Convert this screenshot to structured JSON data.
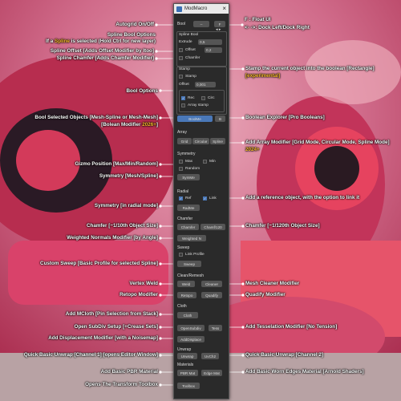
{
  "window": {
    "title": "ModMacro"
  },
  "panel": {
    "bool_label": "Bool",
    "bool_btn": "--",
    "bool_btn_right": "F",
    "spline_bool": "Spline Bool",
    "extrude_label": "Extrude",
    "extrude_value": "0,5",
    "offset_label": "Offset",
    "offset_value": "0,2",
    "chamfer": "Chamfer",
    "stamp_title": "Stamp",
    "stamp": "Stamp",
    "stamp_offset_label": "Offset",
    "stamp_offset_value": "0,001",
    "rec": "Rec",
    "circ": "Circ",
    "array_stamp": "Array stamp",
    "boolme": "BoolMe",
    "boolme_right": "B",
    "array_title": "Array",
    "array_grid": "Grid",
    "array_circular": "Circular",
    "array_spline": "Spline",
    "symmetry_title": "Symmetry",
    "max": "Max",
    "min": "Min",
    "random": "Random",
    "symme": "SymMe",
    "radial_title": "Radial",
    "ref": "Ref",
    "link": "Link",
    "radme": "RadMe",
    "chamfer_title": "Chamfer",
    "chamfer_10": "Chamfer",
    "chamfer_120": "Chamf/120",
    "weighted_n": "Weighted N",
    "sweep_title": "Sweep",
    "link_profile": "Link Profile",
    "sweep": "Sweep",
    "cleanremesh_title": "Clean/Remesh",
    "weld": "Weld",
    "cleaner": "Cleaner",
    "retopo": "Retopo",
    "quadify": "Quadify",
    "cloth_title": "Cloth",
    "cloth": "Cloth",
    "opensubdiv": "OpenSubdiv",
    "tess": "Tess",
    "adddisplace": "AddDisplace",
    "unwrap_title": "Unwrap",
    "unwrap": "Unwrap",
    "uvch2": "UvCh2",
    "materials_title": "Materials",
    "pbr_mat": "PBR Mat",
    "edge_mat": "Edge Mat",
    "toolbox": "Toolbox"
  },
  "left_callouts": {
    "autogrid": "Autogrid On/Off",
    "spline_bool_options": "Spline Bool Options",
    "spline_hint_pre": "If a ",
    "spline_hint_word": "Spline",
    "spline_hint_post": " is selected (Hold Ctrl for new layer)",
    "spline_offset": "Spline Offset [Adds Offset Modifier by Itoo]",
    "spline_chamfer": "Spline Chamfer  [Adds Chamfer Modifier]",
    "bool_options": "Bool Options",
    "bool_selected": "Bool Selected Objects [Mesh-Spline or Mesh-Mesh]",
    "bool_modifier_pre": "[Bolean Modifier ",
    "bool_modifier_ver": "2026+",
    "bool_modifier_post": "]",
    "gizmo_position": "Gizmo Position [Max/Min/Random]",
    "symmetry": "Symmetry [Mesh/Spline]",
    "symmetry_radial": "Symmetry [in radial mode]",
    "chamfer": "Chamfer [~1/10th Object Size]",
    "weighted_normals": "Weighted Normals Modifier [by Angle]",
    "custom_sweep": "Custom Sweep  [Basic Profile for selected Spline]",
    "vertex_weld": "Vertex Weld",
    "retopo": "Retopo Modifier",
    "mcloth": "Add MCloth [Pin Selection from Stack]",
    "open_subdiv": "Open SubDiv Setup [+Crease Sets]",
    "displacement": "Add Displacement Modifier [with a Noisemap]",
    "quick_unwrap1": "Quick Basic Unwrap [Channel 1] [opens Editor Window]",
    "pbr": "Add Basic PBR Material",
    "transform_toolbox": "Opens The Transform Toolbox"
  },
  "right_callouts": {
    "float_ui": "F : Float UI",
    "dock": "<- ->: Dock Left/Dock Right",
    "stamp": "Stamp the current object into the boolean [Rectangle]",
    "stamp_exp": "[experimental]",
    "boolean_explorer": "Boolean Explorer [Pro Booleans]",
    "add_array": "Add Array Modifier [Grid Mode, Circular Mode, Spline Mode]",
    "add_array_ver": "2024+",
    "reference": "Add a reference object, with the option to link it",
    "chamfer": "Chamfer [~1/120th Object Size]",
    "mesh_cleaner": "Mesh Cleaner Modifier",
    "quadify": "Quadify Modifier",
    "tesselation": "Add Tesselation Modifier [No Tension]",
    "quick_unwrap2": "Quick Basic Unwrap [Channel 2]",
    "worn_edges": "Add Basic Worn Edges Material [Arnold Shaders]"
  },
  "colors": {
    "highlight": "#ffbf2e",
    "accent": "#4a78b8",
    "panel": "#2a2a2a"
  }
}
